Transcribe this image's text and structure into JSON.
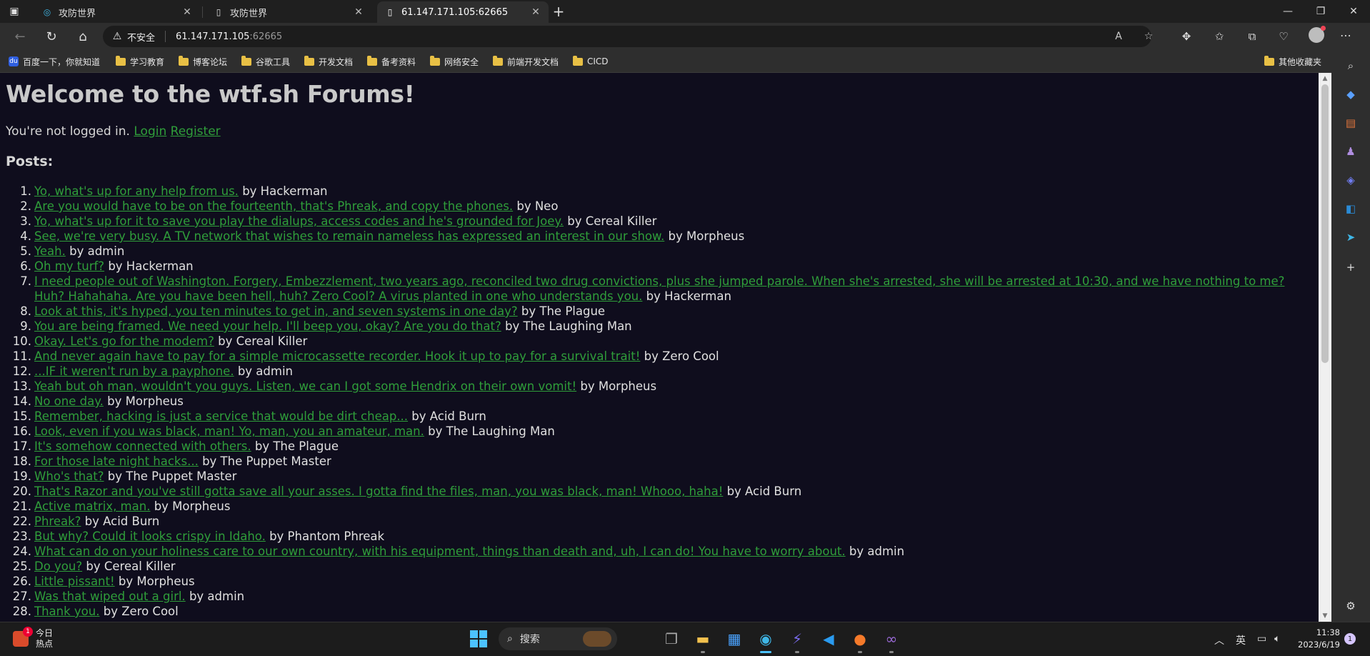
{
  "browser": {
    "tabs": [
      {
        "title": "攻防世界",
        "icon": "adworld-favicon"
      },
      {
        "title": "攻防世界",
        "icon": "page-icon"
      },
      {
        "title": "61.147.171.105:62665",
        "icon": "page-icon"
      }
    ],
    "address": {
      "security_label": "不安全",
      "host": "61.147.171.105",
      "port": ":62665"
    },
    "bookmarks": [
      "百度一下，你就知道",
      "学习教育",
      "博客论坛",
      "谷歌工具",
      "开发文档",
      "备考资料",
      "网络安全",
      "前端开发文档",
      "CICD"
    ],
    "other_bookmarks": "其他收藏夹"
  },
  "page": {
    "title": "Welcome to the wtf.sh Forums!",
    "login_prefix": "You're not logged in.",
    "login_link": "Login",
    "register_link": "Register",
    "posts_heading": "Posts:",
    "posts": [
      {
        "num": "1.",
        "title": "Yo, what's up for any help from us.",
        "author": "by Hackerman"
      },
      {
        "num": "2.",
        "title": "Are you would have to be on the fourteenth, that's Phreak, and copy the phones.",
        "author": "by Neo"
      },
      {
        "num": "3.",
        "title": "Yo, what's up for it to save you play the dialups, access codes and he's grounded for Joey.",
        "author": "by Cereal Killer"
      },
      {
        "num": "4.",
        "title": "See, we're very busy. A TV network that wishes to remain nameless has expressed an interest in our show.",
        "author": "by Morpheus"
      },
      {
        "num": "5.",
        "title": "Yeah.",
        "author": "by admin"
      },
      {
        "num": "6.",
        "title": "Oh my turf?",
        "author": "by Hackerman"
      },
      {
        "num": "7.",
        "title": "I need people out of Washington. Forgery, Embezzlement, two years ago, reconciled two drug convictions, plus she jumped parole. When she's arrested, she will be arrested at 10:30, and we have nothing to me? Huh? Hahahaha. Are you have been hell, huh? Zero Cool? A virus planted in one who understands you.",
        "author": "by Hackerman"
      },
      {
        "num": "8.",
        "title": "Look at this, it's hyped, you ten minutes to get in, and seven systems in one day?",
        "author": "by The Plague"
      },
      {
        "num": "9.",
        "title": "You are being framed. We need your help. I'll beep you, okay? Are you do that?",
        "author": "by The Laughing Man"
      },
      {
        "num": "10.",
        "title": "Okay. Let's go for the modem?",
        "author": "by Cereal Killer"
      },
      {
        "num": "11.",
        "title": "And never again have to pay for a simple microcassette recorder. Hook it up to pay for a survival trait!",
        "author": "by Zero Cool"
      },
      {
        "num": "12.",
        "title": "...IF it weren't run by a payphone.",
        "author": "by admin"
      },
      {
        "num": "13.",
        "title": "Yeah but oh man, wouldn't you guys. Listen, we can I got some Hendrix on their own vomit!",
        "author": "by Morpheus"
      },
      {
        "num": "14.",
        "title": "No one day.",
        "author": "by Morpheus"
      },
      {
        "num": "15.",
        "title": "Remember, hacking is just a service that would be dirt cheap...",
        "author": "by Acid Burn"
      },
      {
        "num": "16.",
        "title": "Look, even if you was black, man! Yo, man, you an amateur, man.",
        "author": "by The Laughing Man"
      },
      {
        "num": "17.",
        "title": "It's somehow connected with others.",
        "author": "by The Plague"
      },
      {
        "num": "18.",
        "title": "For those late night hacks...",
        "author": "by The Puppet Master"
      },
      {
        "num": "19.",
        "title": "Who's that?",
        "author": "by The Puppet Master"
      },
      {
        "num": "20.",
        "title": "That's Razor and you've still gotta save all your asses. I gotta find the files, man, you was black, man! Whooo, haha!",
        "author": "by Acid Burn"
      },
      {
        "num": "21.",
        "title": "Active matrix, man.",
        "author": "by Morpheus"
      },
      {
        "num": "22.",
        "title": "Phreak?",
        "author": "by Acid Burn"
      },
      {
        "num": "23.",
        "title": "But why? Could it looks crispy in Idaho.",
        "author": "by Phantom Phreak"
      },
      {
        "num": "24.",
        "title": "What can do on your holiness care to our own country, with his equipment, things than death and, uh, I can do! You have to worry about.",
        "author": "by admin"
      },
      {
        "num": "25.",
        "title": "Do you?",
        "author": "by Cereal Killer"
      },
      {
        "num": "26.",
        "title": "Little pissant!",
        "author": "by Morpheus"
      },
      {
        "num": "27.",
        "title": "Was that wiped out a girl.",
        "author": "by admin"
      },
      {
        "num": "28.",
        "title": "Thank you.",
        "author": "by Zero Cool"
      }
    ]
  },
  "taskbar": {
    "news_badge": "1",
    "news_line1": "今日",
    "news_line2": "热点",
    "search_placeholder": "搜索",
    "ime": "英",
    "time": "11:38",
    "date": "2023/6/19",
    "notifications": "1"
  },
  "colors": {
    "page_bg": "#0f0d1d",
    "link": "#2f9e3a",
    "heading": "#c9c9c9"
  }
}
